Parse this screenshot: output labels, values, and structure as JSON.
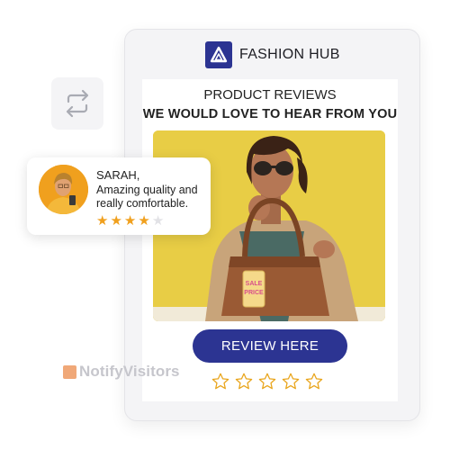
{
  "brand": {
    "name": "FASHION HUB",
    "icon": "triangle-logo-icon",
    "color": "#2c3492"
  },
  "card": {
    "title": "PRODUCT REVIEWS",
    "subtitle": "WE WOULD LOVE TO HEAR FROM YOU",
    "button_label": "REVIEW HERE",
    "rating_stars": 5
  },
  "photo": {
    "tag_line1": "SALE",
    "tag_line2": "PRICE",
    "background": "#e8cd45"
  },
  "review": {
    "name": "SARAH,",
    "text": "Amazing quality and really comfortable.",
    "rating": 4,
    "max_rating": 5,
    "star_color": "#f0a01e"
  },
  "watermark": {
    "prefix": "Notify",
    "suffix": "Visitors"
  },
  "icons": {
    "swap": "repeat-icon"
  }
}
